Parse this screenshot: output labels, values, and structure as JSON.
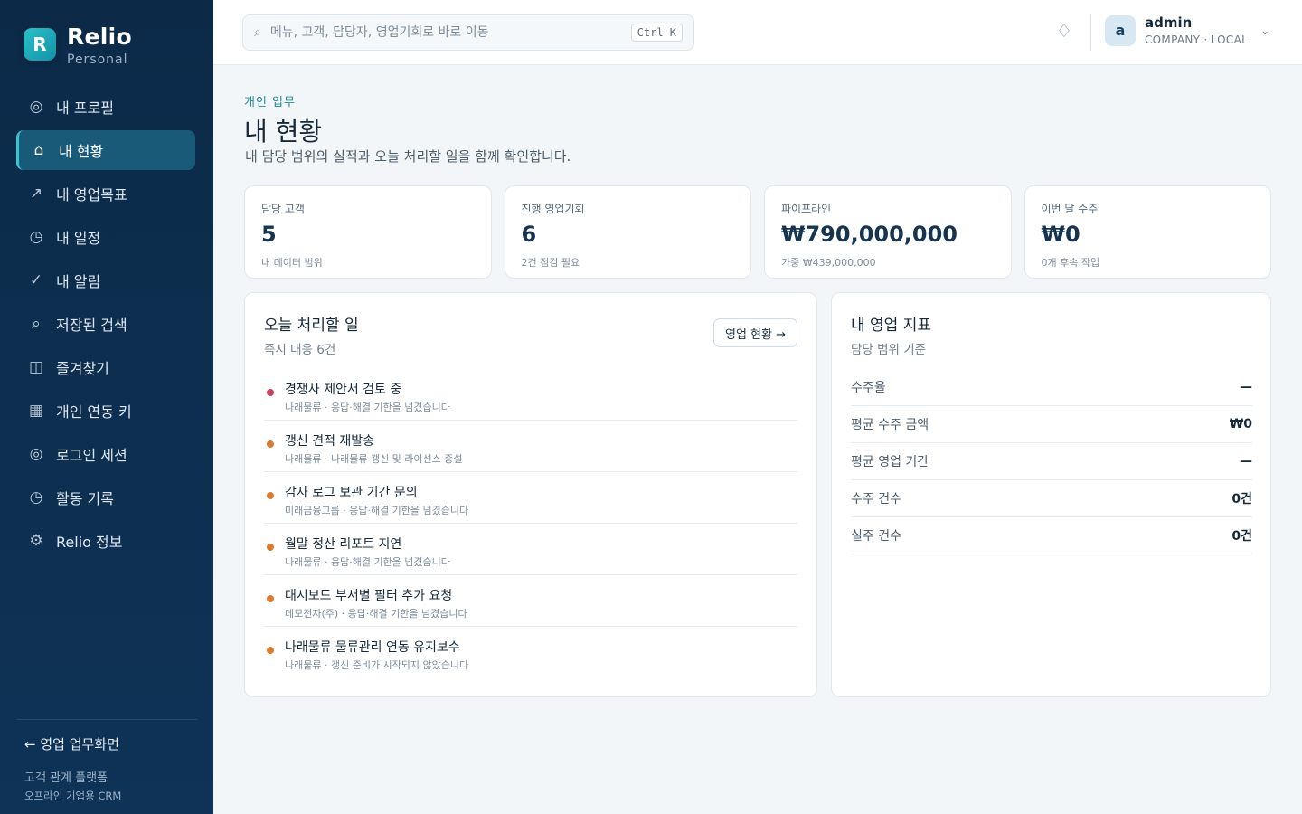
{
  "brand": {
    "logo_letter": "R",
    "name": "Relio",
    "sub": "Personal"
  },
  "nav": [
    {
      "icon": "◎",
      "label": "내 프로필"
    },
    {
      "icon": "⌂",
      "label": "내 현황",
      "active": true
    },
    {
      "icon": "↗",
      "label": "내 영업목표"
    },
    {
      "icon": "◷",
      "label": "내 일정"
    },
    {
      "icon": "✓",
      "label": "내 알림"
    },
    {
      "icon": "⌕",
      "label": "저장된 검색"
    },
    {
      "icon": "◫",
      "label": "즐겨찾기"
    },
    {
      "icon": "▦",
      "label": "개인 연동 키"
    },
    {
      "icon": "◎",
      "label": "로그인 세션"
    },
    {
      "icon": "◷",
      "label": "활동 기록"
    },
    {
      "icon": "⚙",
      "label": "Relio 정보"
    }
  ],
  "footer": {
    "back": "← 영업 업무화면",
    "line1": "고객 관계 플랫폼",
    "line2": "오프라인 기업용 CRM"
  },
  "search": {
    "icon": "⌕",
    "placeholder": "메뉴, 고객, 담당자, 영업기회로 바로 이동",
    "shortcut": "Ctrl K"
  },
  "topbar": {
    "bell_icon": "♢"
  },
  "user": {
    "avatar": "a",
    "name": "admin",
    "org": "COMPANY · LOCAL",
    "chevron": "⌄"
  },
  "page": {
    "eyebrow": "개인 업무",
    "title": "내 현황",
    "desc": "내 담당 범위의 실적과 오늘 처리할 일을 함께 확인합니다."
  },
  "stats": [
    {
      "label": "담당 고객",
      "value": "5",
      "note": "내 데이터 범위"
    },
    {
      "label": "진행 영업기회",
      "value": "6",
      "note": "2건 점검 필요"
    },
    {
      "label": "파이프라인",
      "value": "₩790,000,000",
      "note": "가중 ₩439,000,000"
    },
    {
      "label": "이번 달 수주",
      "value": "₩0",
      "note": "0개 후속 작업"
    }
  ],
  "todo": {
    "title": "오늘 처리할 일",
    "sub": "즉시 대응 6건",
    "button": "영업 현황 →",
    "items": [
      {
        "title": "경쟁사 제안서 검토 중",
        "meta": "나래물류 · 응답·해결 기한을 넘겼습니다",
        "color": "#c8435a"
      },
      {
        "title": "갱신 견적 재발송",
        "meta": "나래물류 · 나래물류 갱신 및 라이선스 증설",
        "color": "#e07b2e"
      },
      {
        "title": "감사 로그 보관 기간 문의",
        "meta": "미래금융그룹 · 응답·해결 기한을 넘겼습니다",
        "color": "#e07b2e"
      },
      {
        "title": "월말 정산 리포트 지연",
        "meta": "나래물류 · 응답·해결 기한을 넘겼습니다",
        "color": "#e07b2e"
      },
      {
        "title": "대시보드 부서별 필터 추가 요청",
        "meta": "데모전자(주) · 응답·해결 기한을 넘겼습니다",
        "color": "#e07b2e"
      },
      {
        "title": "나래물류 물류관리 연동 유지보수",
        "meta": "나래물류 · 갱신 준비가 시작되지 않았습니다",
        "color": "#e07b2e"
      }
    ]
  },
  "kpi": {
    "title": "내 영업 지표",
    "sub": "담당 범위 기준",
    "rows": [
      {
        "label": "수주율",
        "value": "—"
      },
      {
        "label": "평균 수주 금액",
        "value": "₩0"
      },
      {
        "label": "평균 영업 기간",
        "value": "—"
      },
      {
        "label": "수주 건수",
        "value": "0건"
      },
      {
        "label": "실주 건수",
        "value": "0건"
      }
    ]
  },
  "colors": {
    "sidebar": "#0c2a48",
    "accent": "#37c6cf",
    "active_nav": "#185a78",
    "overdue": "#c8435a",
    "warning": "#e07b2e"
  }
}
